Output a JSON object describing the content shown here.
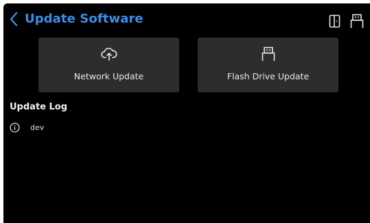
{
  "header": {
    "title": "Update Software",
    "back_icon": "chevron-left-icon",
    "exit_icon": "door-icon",
    "usb_icon": "usb-icon"
  },
  "cards": {
    "network": {
      "label": "Network Update",
      "icon": "cloud-upload-icon"
    },
    "flash": {
      "label": "Flash Drive Update",
      "icon": "usb-icon"
    }
  },
  "log": {
    "title": "Update Log",
    "entries": [
      {
        "icon": "info-icon",
        "text": "dev"
      }
    ]
  },
  "colors": {
    "accent": "#3a8fe8",
    "background": "#000000",
    "card": "#2d2d2d",
    "text": "#e8e8e8"
  }
}
